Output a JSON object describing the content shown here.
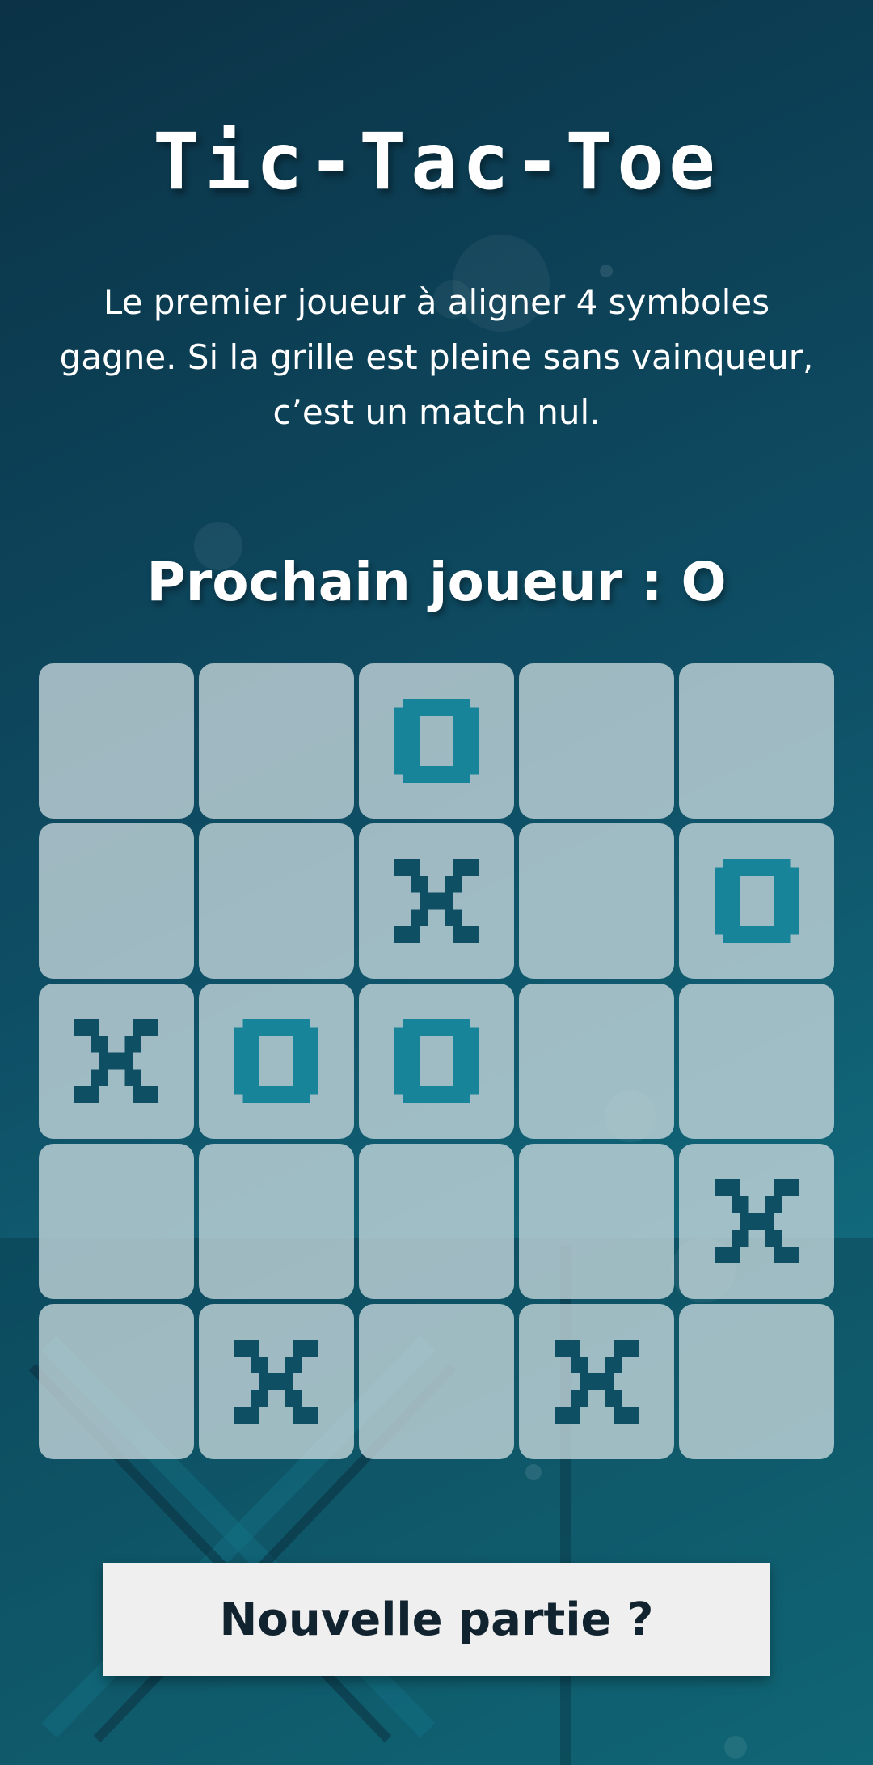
{
  "game": {
    "title": "Tic-Tac-Toe",
    "rules": "Le premier joueur à aligner 4 symboles gagne. Si la grille est pleine sans vainqueur, c’est un match nul.",
    "next_player": "Prochain joueur : O",
    "board": [
      [
        "",
        "",
        "O",
        "",
        ""
      ],
      [
        "",
        "",
        "X",
        "",
        "O"
      ],
      [
        "X",
        "O",
        "O",
        "",
        ""
      ],
      [
        "",
        "",
        "",
        "",
        "X"
      ],
      [
        "",
        "X",
        "",
        "X",
        ""
      ]
    ],
    "new_game_label": "Nouvelle partie ?"
  },
  "colors": {
    "x_mark": "#0f4f63",
    "o_mark": "#17849a",
    "cell_bg": "#cddce0",
    "button_bg": "#efefef",
    "button_text": "#10232f"
  }
}
